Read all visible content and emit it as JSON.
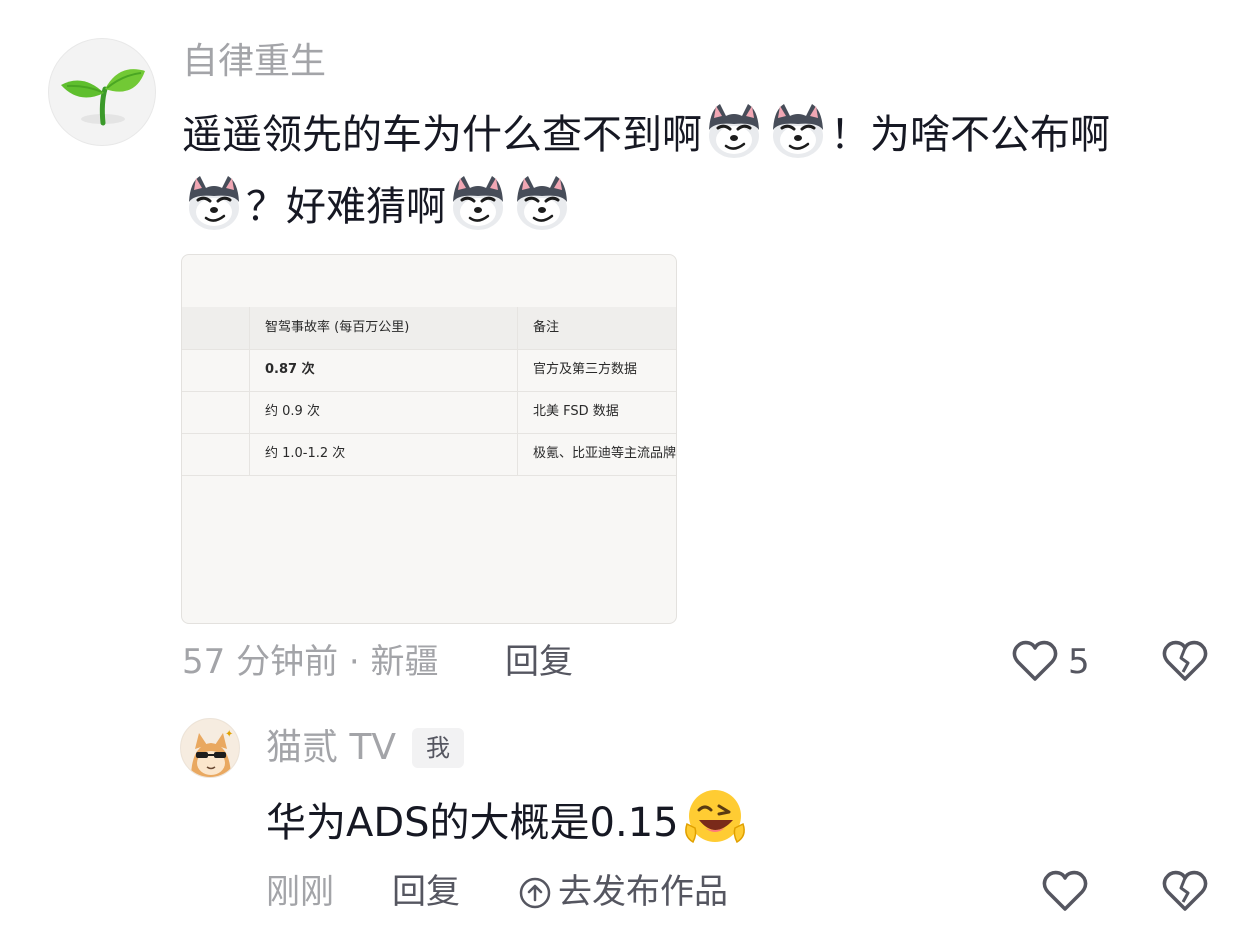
{
  "comment": {
    "username": "自律重生",
    "text_line1_a": "遥遥领先的车为什么查不到啊",
    "text_line1_b": "！为啥不公布啊",
    "text_line2_a": "？好难猜啊",
    "image_table": {
      "headers": [
        "智驾事故率 (每百万公里)",
        "备注"
      ],
      "rows": [
        [
          "0.87 次",
          "官方及第三方数据"
        ],
        [
          "约 0.9 次",
          "北美 FSD 数据"
        ],
        [
          "约 1.0-1.2 次",
          "极氪、比亚迪等主流品牌"
        ]
      ]
    },
    "meta": "57 分钟前 · 新疆",
    "reply_label": "回复",
    "like_count": "5"
  },
  "reply": {
    "username": "猫贰 TV",
    "badge": "我",
    "text": "华为ADS的大概是0.15",
    "meta": "刚刚",
    "reply_label": "回复",
    "publish_label": "去发布作品"
  },
  "icons": {
    "like": "heart-outline-icon",
    "dislike": "broken-heart-icon",
    "emoji_wolf": "smirking-wolf-emoji",
    "emoji_wink": "winking-laughing-emoji",
    "publish": "up-arrow-circle-icon"
  },
  "colors": {
    "primary_text": "#161823",
    "secondary_text": "#a3a4a8",
    "action_text": "#555660"
  }
}
